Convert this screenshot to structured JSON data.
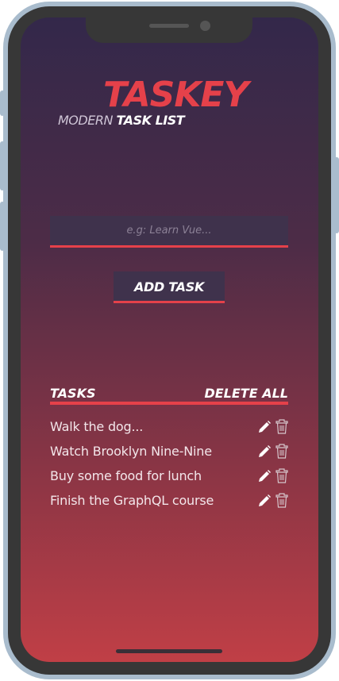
{
  "app": {
    "logo": "TASKEY",
    "subtitle_light": "MODERN",
    "subtitle_bold": "TASK LIST"
  },
  "form": {
    "input_value": "",
    "input_placeholder": "e.g: Learn Vue...",
    "add_button_label": "ADD TASK"
  },
  "list": {
    "header_label": "TASKS",
    "delete_all_label": "DELETE ALL",
    "tasks": [
      {
        "text": "Walk the dog..."
      },
      {
        "text": "Watch Brooklyn Nine-Nine"
      },
      {
        "text": "Buy some food for lunch"
      },
      {
        "text": "Finish the GraphQL course"
      }
    ]
  },
  "icons": {
    "edit": "pencil-icon",
    "delete": "trash-icon"
  },
  "colors": {
    "accent": "#e5414a",
    "gradient_top": "#33284a",
    "gradient_bottom": "#c03f46",
    "panel": "#3f324c"
  }
}
